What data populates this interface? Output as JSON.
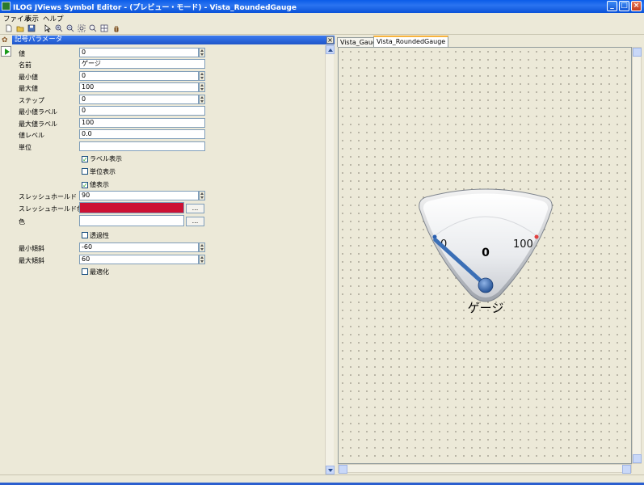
{
  "window": {
    "title": "ILOG JViews Symbol Editor - (プレビュー・モード) - Vista_RoundedGauge",
    "minimize_glyph": "_",
    "maximize_glyph": "□",
    "close_glyph": "×"
  },
  "menu": {
    "file": "ファイル",
    "view": "表示",
    "help": "ヘルプ"
  },
  "panel": {
    "title": "記号パラメータ",
    "close_glyph": "×"
  },
  "params": {
    "value": {
      "label": "値",
      "value": "0"
    },
    "name": {
      "label": "名前",
      "value": "ゲージ"
    },
    "min": {
      "label": "最小値",
      "value": "0"
    },
    "max": {
      "label": "最大値",
      "value": "100"
    },
    "step": {
      "label": "ステップ",
      "value": "0"
    },
    "min_label": {
      "label": "最小値ラベル",
      "value": "0"
    },
    "max_label": {
      "label": "最大値ラベル",
      "value": "100"
    },
    "value_level": {
      "label": "値レベル",
      "value": "0.0"
    },
    "unit": {
      "label": "単位",
      "value": ""
    },
    "show_labels": {
      "label": "ラベル表示",
      "checked": true
    },
    "show_unit": {
      "label": "単位表示",
      "checked": false
    },
    "show_value": {
      "label": "値表示",
      "checked": true
    },
    "threshold": {
      "label": "スレッシュホールド",
      "value": "90"
    },
    "threshold_color": {
      "label": "スレッシュホールド色",
      "color": "#cc1133",
      "button": "..."
    },
    "color": {
      "label": "色",
      "color": "#ffffff",
      "button": "..."
    },
    "transparency": {
      "label": "透過性",
      "checked": false
    },
    "min_tilt": {
      "label": "最小傾斜",
      "value": "-60"
    },
    "max_tilt": {
      "label": "最大傾斜",
      "value": "60"
    },
    "optimize": {
      "label": "最適化",
      "checked": false
    }
  },
  "tabs": [
    {
      "label": "Vista_Gauge",
      "active": false
    },
    {
      "label": "Vista_RoundedGauge",
      "active": true
    }
  ],
  "gauge": {
    "min_label": "0",
    "max_label": "100",
    "value_text": "0",
    "name_text": "ゲージ",
    "value": 0,
    "min": 0,
    "max": 100,
    "needle_color": "#3b6fb6",
    "min_dot_color": "#2a5fb0",
    "max_dot_color": "#e04040"
  }
}
